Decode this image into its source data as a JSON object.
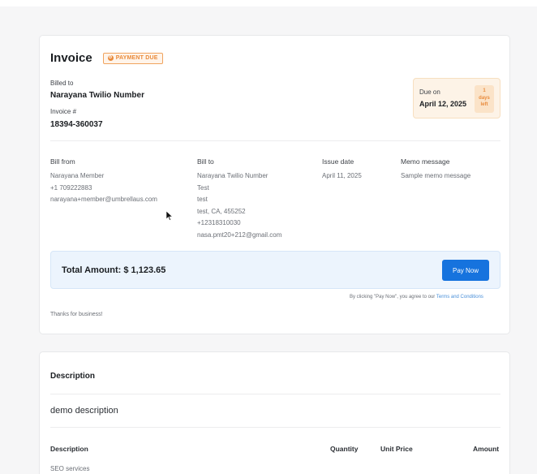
{
  "invoice": {
    "title": "Invoice",
    "status_badge": "PAYMENT DUE",
    "billed_to_label": "Billed to",
    "billed_to_name": "Narayana Twilio Number",
    "invoice_no_label": "Invoice #",
    "invoice_no": "18394-360037",
    "due": {
      "label": "Due on",
      "date": "April 12, 2025",
      "days_count": "1",
      "days_word": "days",
      "days_left": "left"
    }
  },
  "details": {
    "bill_from": {
      "label": "Bill from",
      "lines": [
        "Narayana Member",
        "+1 709222883",
        "narayana+member@umbrellaus.com"
      ]
    },
    "bill_to": {
      "label": "Bill to",
      "lines": [
        "Narayana Twilio Number",
        "Test",
        "test",
        "test, CA, 455252",
        "+12318310030",
        "nasa.pmt20+212@gmail.com"
      ]
    },
    "issue_date": {
      "label": "Issue date",
      "value": "April 11, 2025"
    },
    "memo": {
      "label": "Memo message",
      "value": "Sample memo message"
    }
  },
  "payment": {
    "total_label": "Total Amount: $ 1,123.65",
    "pay_button": "Pay Now",
    "agree_prefix": "By clicking \"Pay Now\", you agree to our",
    "terms_link": "Terms and Conditions",
    "thanks": "Thanks for business!"
  },
  "description_section": {
    "heading": "Description",
    "text": "demo description",
    "table": {
      "headers": [
        "Description",
        "Quantity",
        "Unit Price",
        "Amount"
      ],
      "first_row_item": "SEO services"
    }
  },
  "colors": {
    "accent": "#1673de",
    "badge_orange": "#e98b3c",
    "total_bar_bg": "#ecf4fd",
    "due_box_bg": "#fdf3e7"
  }
}
